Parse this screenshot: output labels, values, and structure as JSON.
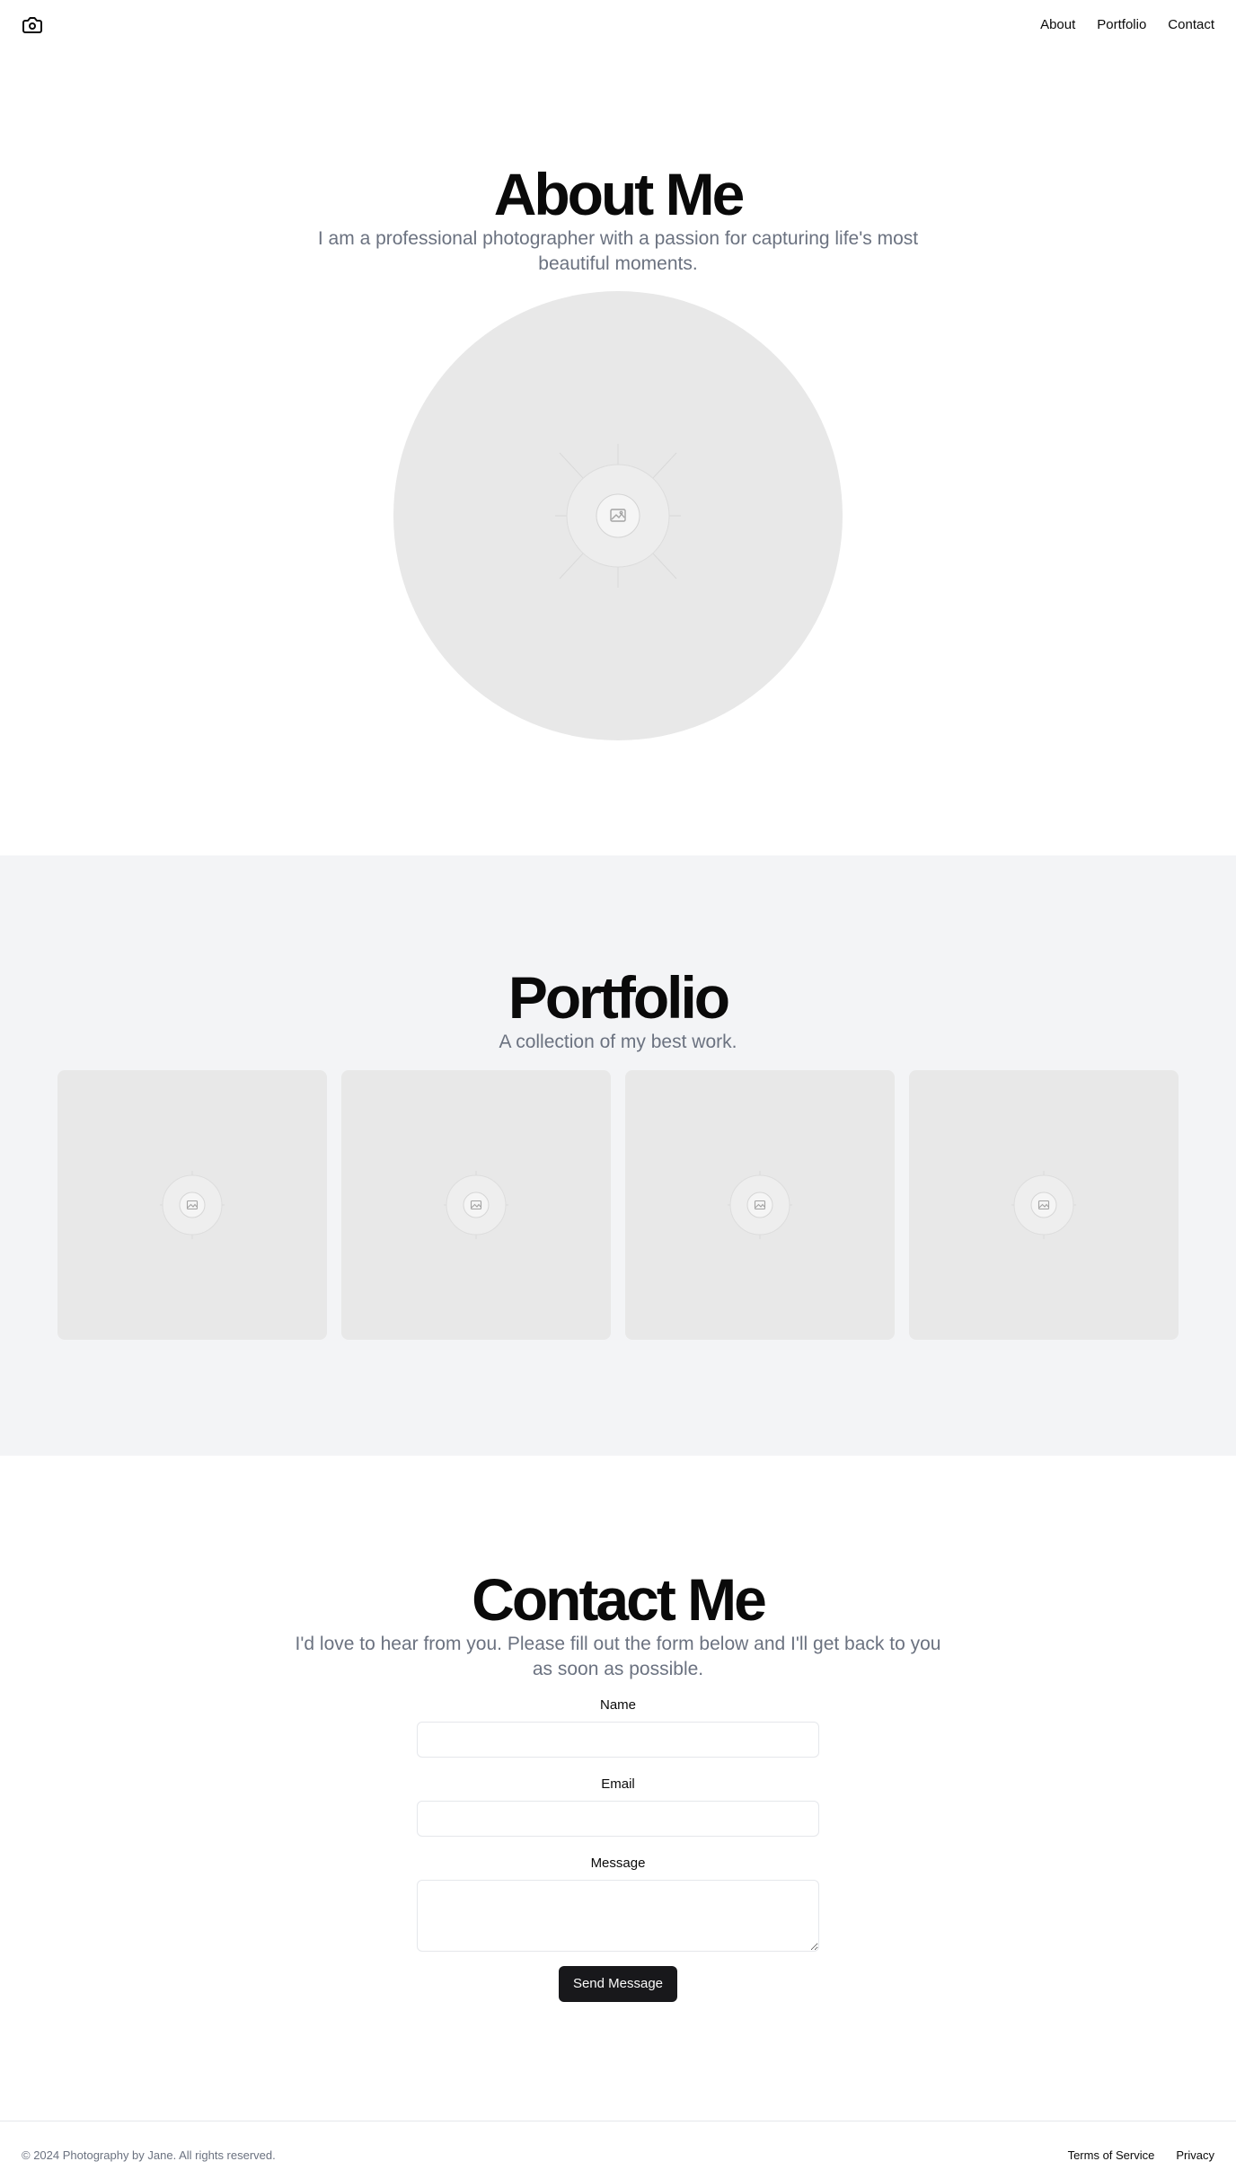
{
  "header": {
    "logo_icon": "camera-icon",
    "nav": [
      {
        "label": "About"
      },
      {
        "label": "Portfolio"
      },
      {
        "label": "Contact"
      }
    ]
  },
  "about": {
    "title": "About Me",
    "subtitle": "I am a professional photographer with a passion for capturing life's most beautiful moments.",
    "image_icon": "image-placeholder-icon"
  },
  "portfolio": {
    "title": "Portfolio",
    "subtitle": "A collection of my best work.",
    "tiles": [
      {
        "icon": "image-placeholder-icon"
      },
      {
        "icon": "image-placeholder-icon"
      },
      {
        "icon": "image-placeholder-icon"
      },
      {
        "icon": "image-placeholder-icon"
      }
    ]
  },
  "contact": {
    "title": "Contact Me",
    "subtitle": "I'd love to hear from you. Please fill out the form below and I'll get back to you as soon as possible.",
    "name_label": "Name",
    "name_value": "",
    "email_label": "Email",
    "email_value": "",
    "message_label": "Message",
    "message_value": "",
    "submit_label": "Send Message"
  },
  "footer": {
    "copyright": "© 2024 Photography by Jane. All rights reserved.",
    "links": [
      {
        "label": "Terms of Service"
      },
      {
        "label": "Privacy"
      }
    ]
  },
  "colors": {
    "text": "#0a0a0a",
    "muted": "#6b7280",
    "placeholder_bg": "#e8e8e8",
    "section_alt_bg": "#f3f4f6",
    "button_bg": "#18181b",
    "border": "#e5e7eb"
  }
}
